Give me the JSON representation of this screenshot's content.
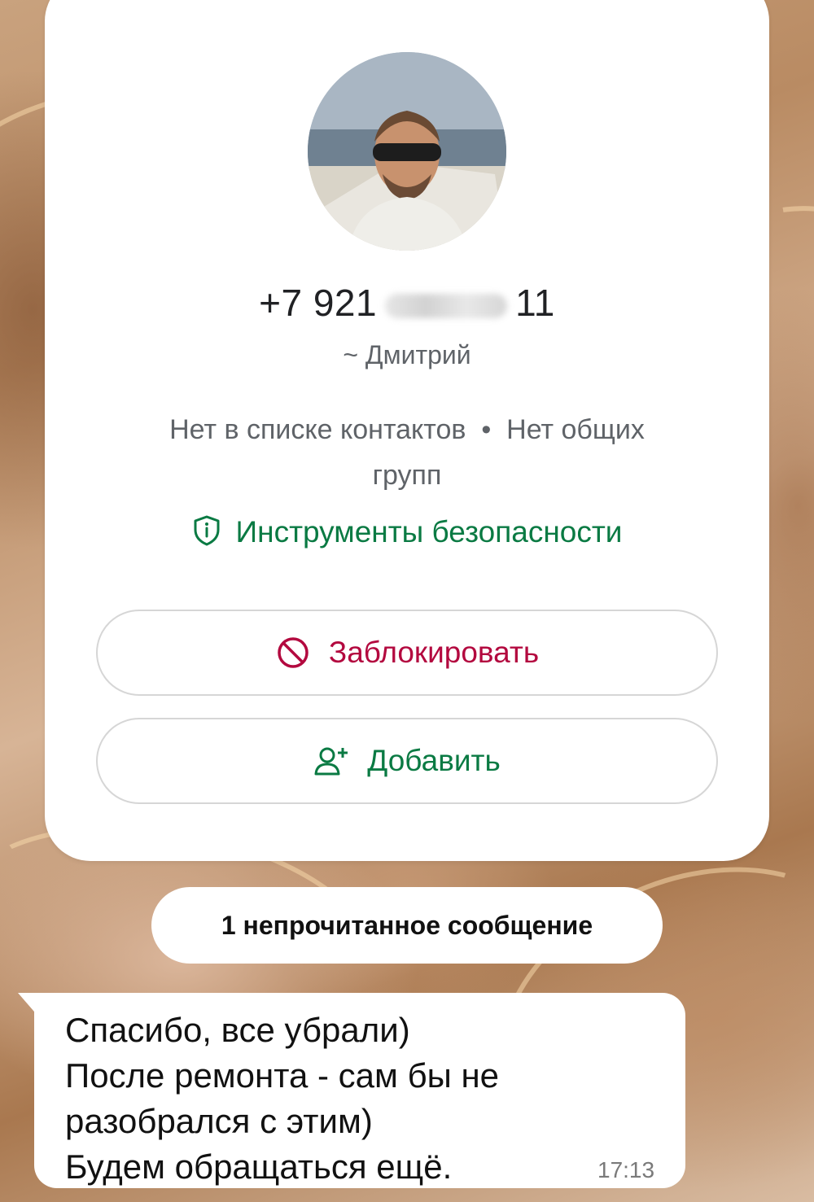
{
  "contact": {
    "phone_prefix": "+7 921",
    "phone_suffix": "11",
    "display_name": "~ Дмитрий",
    "status_line_1": "Нет в списке контактов  •  Нет общих",
    "status_line_2": "групп",
    "avatar_icon": "profile-photo"
  },
  "actions": {
    "security_label": "Инструменты безопасности",
    "security_icon": "shield-icon",
    "block_label": "Заблокировать",
    "block_icon": "block-icon",
    "add_label": "Добавить",
    "add_icon": "add-contact-icon"
  },
  "chat": {
    "unread_label": "1 непрочитанное сообщение",
    "message": {
      "lines": [
        "Спасибо, все убрали)",
        "После ремонта - сам бы не",
        "разобрался с этим)",
        "Будем обращаться ещё."
      ],
      "time": "17:13"
    }
  },
  "colors": {
    "accent_green": "#0a7a43",
    "danger_red": "#b3093f",
    "card_background": "#ffffff"
  }
}
